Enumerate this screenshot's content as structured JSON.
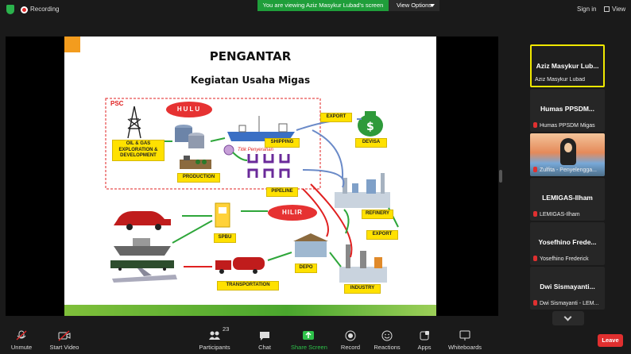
{
  "top_bar": {
    "recording_label": "Recording",
    "viewing_banner": "You are viewing Aziz Masykur Lubad's screen",
    "view_options_label": "View Options",
    "sign_in_label": "Sign in",
    "view_label": "View"
  },
  "slide": {
    "title": "PENGANTAR",
    "subtitle": "Kegiatan Usaha Migas",
    "psc_label": "PSC",
    "hulu_label": "HULU",
    "hilir_label": "HILIR",
    "titik_label": "Titik Penyerahan",
    "labels": {
      "oil_gas": "OIL & GAS EXPLORATION & DEVELOPMENT",
      "production": "PRODUCTION",
      "shipping": "SHIPPING",
      "export_top": "EXPORT",
      "devisa": "DEVISA",
      "pipeline": "PIPELINE",
      "refinery": "REFINERY",
      "export_mid": "EXPORT",
      "spbu": "SPBU",
      "depo": "DEPO",
      "transportation": "TRANSPORTATION",
      "industry": "INDUSTRY"
    }
  },
  "participants_panel": [
    {
      "big_name": "Aziz Masykur Lub...",
      "sub_name": "Aziz Masykur Lubad",
      "active": true,
      "muted": false
    },
    {
      "big_name": "Humas PPSDM...",
      "sub_name": "Humas PPSDM Migas",
      "active": false,
      "muted": true
    },
    {
      "big_name": "",
      "sub_name": "Zulfita - Penyelengga...",
      "active": false,
      "muted": true
    },
    {
      "big_name": "LEMIGAS-Ilham",
      "sub_name": "LEMIGAS-Ilham",
      "active": false,
      "muted": true
    },
    {
      "big_name": "Yosefhino Frede...",
      "sub_name": "Yosefhino Frederick",
      "active": false,
      "muted": true
    },
    {
      "big_name": "Dwi Sismayanti...",
      "sub_name": "Dwi Sismayanti - LEM...",
      "active": false,
      "muted": true
    }
  ],
  "toolbar": {
    "unmute": "Unmute",
    "start_video": "Start Video",
    "participants": "Participants",
    "participants_count": "23",
    "chat": "Chat",
    "share_screen": "Share Screen",
    "record": "Record",
    "reactions": "Reactions",
    "apps": "Apps",
    "whiteboards": "Whiteboards",
    "leave": "Leave"
  },
  "colors": {
    "accent_green": "#1f9e3a",
    "leave_red": "#e02f2f",
    "active_speaker": "#f0e800",
    "label_yellow": "#ffe100"
  }
}
